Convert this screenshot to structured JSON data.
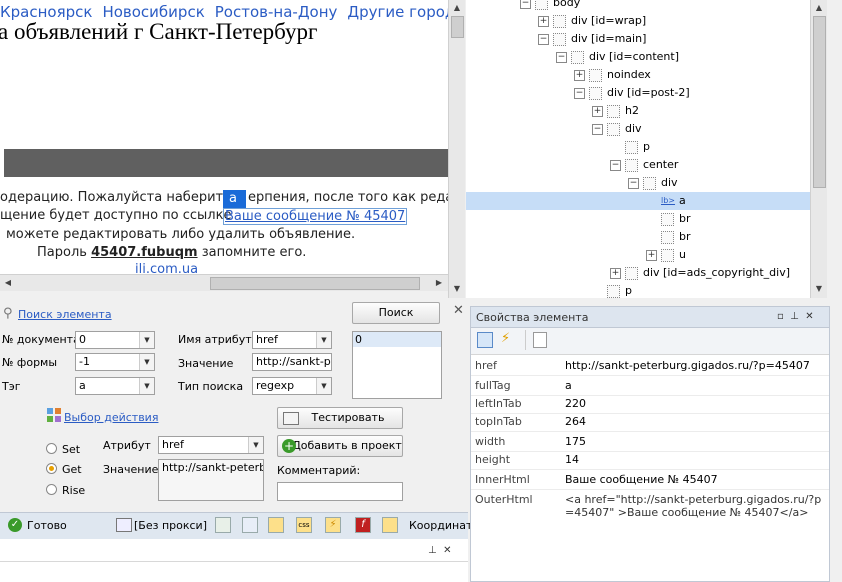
{
  "preview": {
    "cities": [
      "Красноярск",
      "Новосибирск",
      "Ростов-на-Дону",
      "Другие города"
    ],
    "heading": "а объявлений г Санкт-Петербург",
    "line1_left": "одерацию. Пожалуйста наберите",
    "highlight": "а",
    "line1_right": "ерпения, после того как редак",
    "line2_left": "щение будет доступно по ссылке",
    "message_link": "Ваше сообщение № 45407",
    "line3": "можете редактировать либо удалить объявление.",
    "line4_pre": "Пароль",
    "password": "45407.fubuqm",
    "line4_post": "запомните его.",
    "line5": "ili.com.ua"
  },
  "tree": {
    "nodes": [
      {
        "label": "body",
        "expander": "−"
      },
      {
        "label": "div [id=wrap]",
        "expander": "+"
      },
      {
        "label": "div [id=main]",
        "expander": "−"
      },
      {
        "label": "div [id=content]",
        "expander": "−"
      },
      {
        "label": "noindex",
        "expander": "+"
      },
      {
        "label": "div [id=post-2]",
        "expander": "−"
      },
      {
        "label": "h2",
        "expander": "+"
      },
      {
        "label": "div",
        "expander": "−"
      },
      {
        "label": "p",
        "expander": ""
      },
      {
        "label": "center",
        "expander": "−"
      },
      {
        "label": "div",
        "expander": "−"
      },
      {
        "label": "a",
        "expander": "",
        "tag_icon": "lb>"
      },
      {
        "label": "br",
        "expander": ""
      },
      {
        "label": "br",
        "expander": ""
      },
      {
        "label": "u",
        "expander": "+"
      },
      {
        "label": "div [id=ads_copyright_div]",
        "expander": "+"
      },
      {
        "label": "p",
        "expander": ""
      }
    ]
  },
  "search": {
    "title": "Поиск элемента",
    "search_button": "Поиск",
    "doc_label": "№ документа",
    "doc_value": "0",
    "form_label": "№ формы",
    "form_value": "-1",
    "tag_label": "Тэг",
    "tag_value": "a",
    "attr_name_label": "Имя атрибута",
    "attr_name_value": "href",
    "value_label": "Значение",
    "value_value": "http://sankt-pe",
    "search_type_label": "Тип поиска",
    "search_type_value": "regexp",
    "results": [
      "0"
    ],
    "action_title": "Выбор действия",
    "test_button": "Тестировать",
    "radio_set": "Set",
    "radio_get": "Get",
    "radio_rise": "Rise",
    "attribute_label": "Атрибут",
    "attribute_value": "href",
    "value2_label": "Значение",
    "value2_value": "http://sankt-peterbu",
    "add_button": "Добавить в проект",
    "comment_label": "Комментарий:",
    "comment_value": ""
  },
  "statusbar": {
    "ready": "Готово",
    "proxy": "[Без прокси]",
    "coords": "Координат"
  },
  "props": {
    "title": "Свойства элемента",
    "rows": [
      {
        "key": "href",
        "value": "http://sankt-peterburg.gigados.ru/?p=45407"
      },
      {
        "key": "fullTag",
        "value": "a"
      },
      {
        "key": "leftInTab",
        "value": "220"
      },
      {
        "key": "topInTab",
        "value": "264"
      },
      {
        "key": "width",
        "value": "175"
      },
      {
        "key": "height",
        "value": "14"
      },
      {
        "key": "InnerHtml",
        "value": "Ваше сообщение № 45407"
      },
      {
        "key": "OuterHtml",
        "value": "<a href=\"http://sankt-peterburg.gigados.ru/?p=45407\" >Ваше сообщение № 45407</a>"
      }
    ]
  },
  "colors": {
    "accent": "#1a6bd8",
    "link": "#2b5cc4",
    "selection": "#c6ddf7"
  }
}
